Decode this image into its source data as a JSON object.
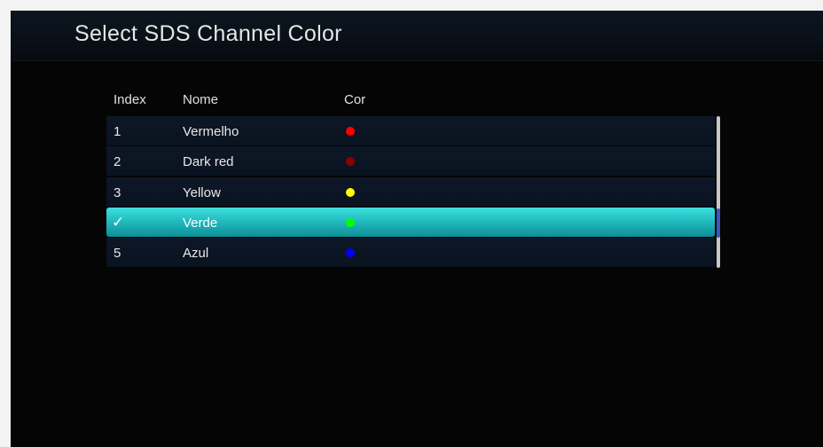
{
  "window": {
    "title": "Select SDS Channel Color"
  },
  "table": {
    "columns": {
      "index": "Index",
      "name": "Nome",
      "color": "Cor"
    },
    "rows": [
      {
        "index": "1",
        "name": "Vermelho",
        "color": "#ff0000",
        "selected": false
      },
      {
        "index": "2",
        "name": "Dark red",
        "color": "#8b0000",
        "selected": false
      },
      {
        "index": "3",
        "name": "Yellow",
        "color": "#ffff00",
        "selected": false
      },
      {
        "index": "",
        "name": "Verde",
        "color": "#00ff00",
        "selected": true,
        "marker": "✓"
      },
      {
        "index": "5",
        "name": "Azul",
        "color": "#0000ff",
        "selected": false
      }
    ]
  },
  "icons": {
    "selected_marker": "check-icon"
  },
  "colors": {
    "selection": "#22bcc0",
    "scroll_thumb": "#3a55c8"
  }
}
